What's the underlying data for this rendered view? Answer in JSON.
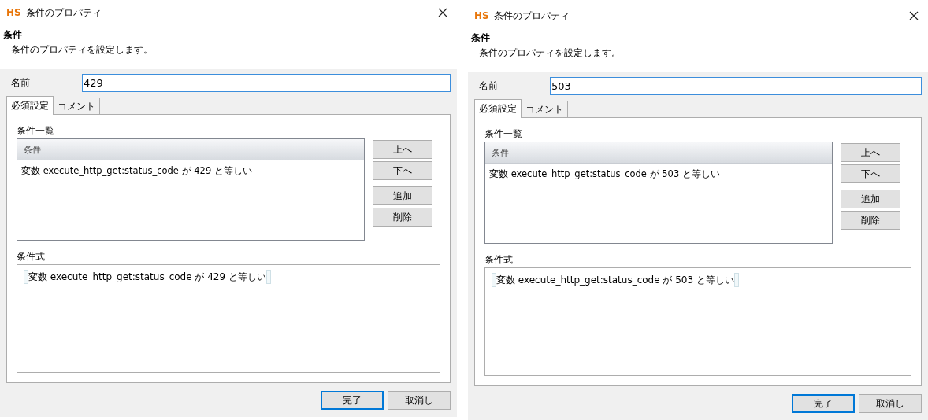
{
  "dialogs": [
    {
      "window": {
        "logo": "HS",
        "title": "条件のプロパティ"
      },
      "header": {
        "title": "条件",
        "description": "条件のプロパティを設定します。"
      },
      "name": {
        "label": "名前",
        "value": "429",
        "focused": true
      },
      "tabs": [
        {
          "label": "必須設定",
          "selected": true
        },
        {
          "label": "コメント",
          "selected": false
        }
      ],
      "condition_list": {
        "label": "条件一覧",
        "columns": [
          "条件"
        ],
        "rows": [
          "変数 execute_http_get:status_code が 429 と等しい"
        ]
      },
      "side_button_groups": [
        [
          "上へ",
          "下へ"
        ],
        [
          "追加",
          "削除"
        ]
      ],
      "expression": {
        "label": "条件式",
        "text": "変数 execute_http_get:status_code が 429 と等しい"
      },
      "buttons": [
        {
          "label": "完了",
          "default": true
        },
        {
          "label": "取消し",
          "default": false
        }
      ]
    },
    {
      "window": {
        "logo": "HS",
        "title": "条件のプロパティ"
      },
      "header": {
        "title": "条件",
        "description": "条件のプロパティを設定します。"
      },
      "name": {
        "label": "名前",
        "value": "503",
        "focused": true
      },
      "tabs": [
        {
          "label": "必須設定",
          "selected": true
        },
        {
          "label": "コメント",
          "selected": false
        }
      ],
      "condition_list": {
        "label": "条件一覧",
        "columns": [
          "条件"
        ],
        "rows": [
          "変数 execute_http_get:status_code が 503 と等しい"
        ]
      },
      "side_button_groups": [
        [
          "上へ",
          "下へ"
        ],
        [
          "追加",
          "削除"
        ]
      ],
      "expression": {
        "label": "条件式",
        "text": "変数 execute_http_get:status_code が 503 と等しい"
      },
      "buttons": [
        {
          "label": "完了",
          "default": true
        },
        {
          "label": "取消し",
          "default": false
        }
      ]
    }
  ]
}
